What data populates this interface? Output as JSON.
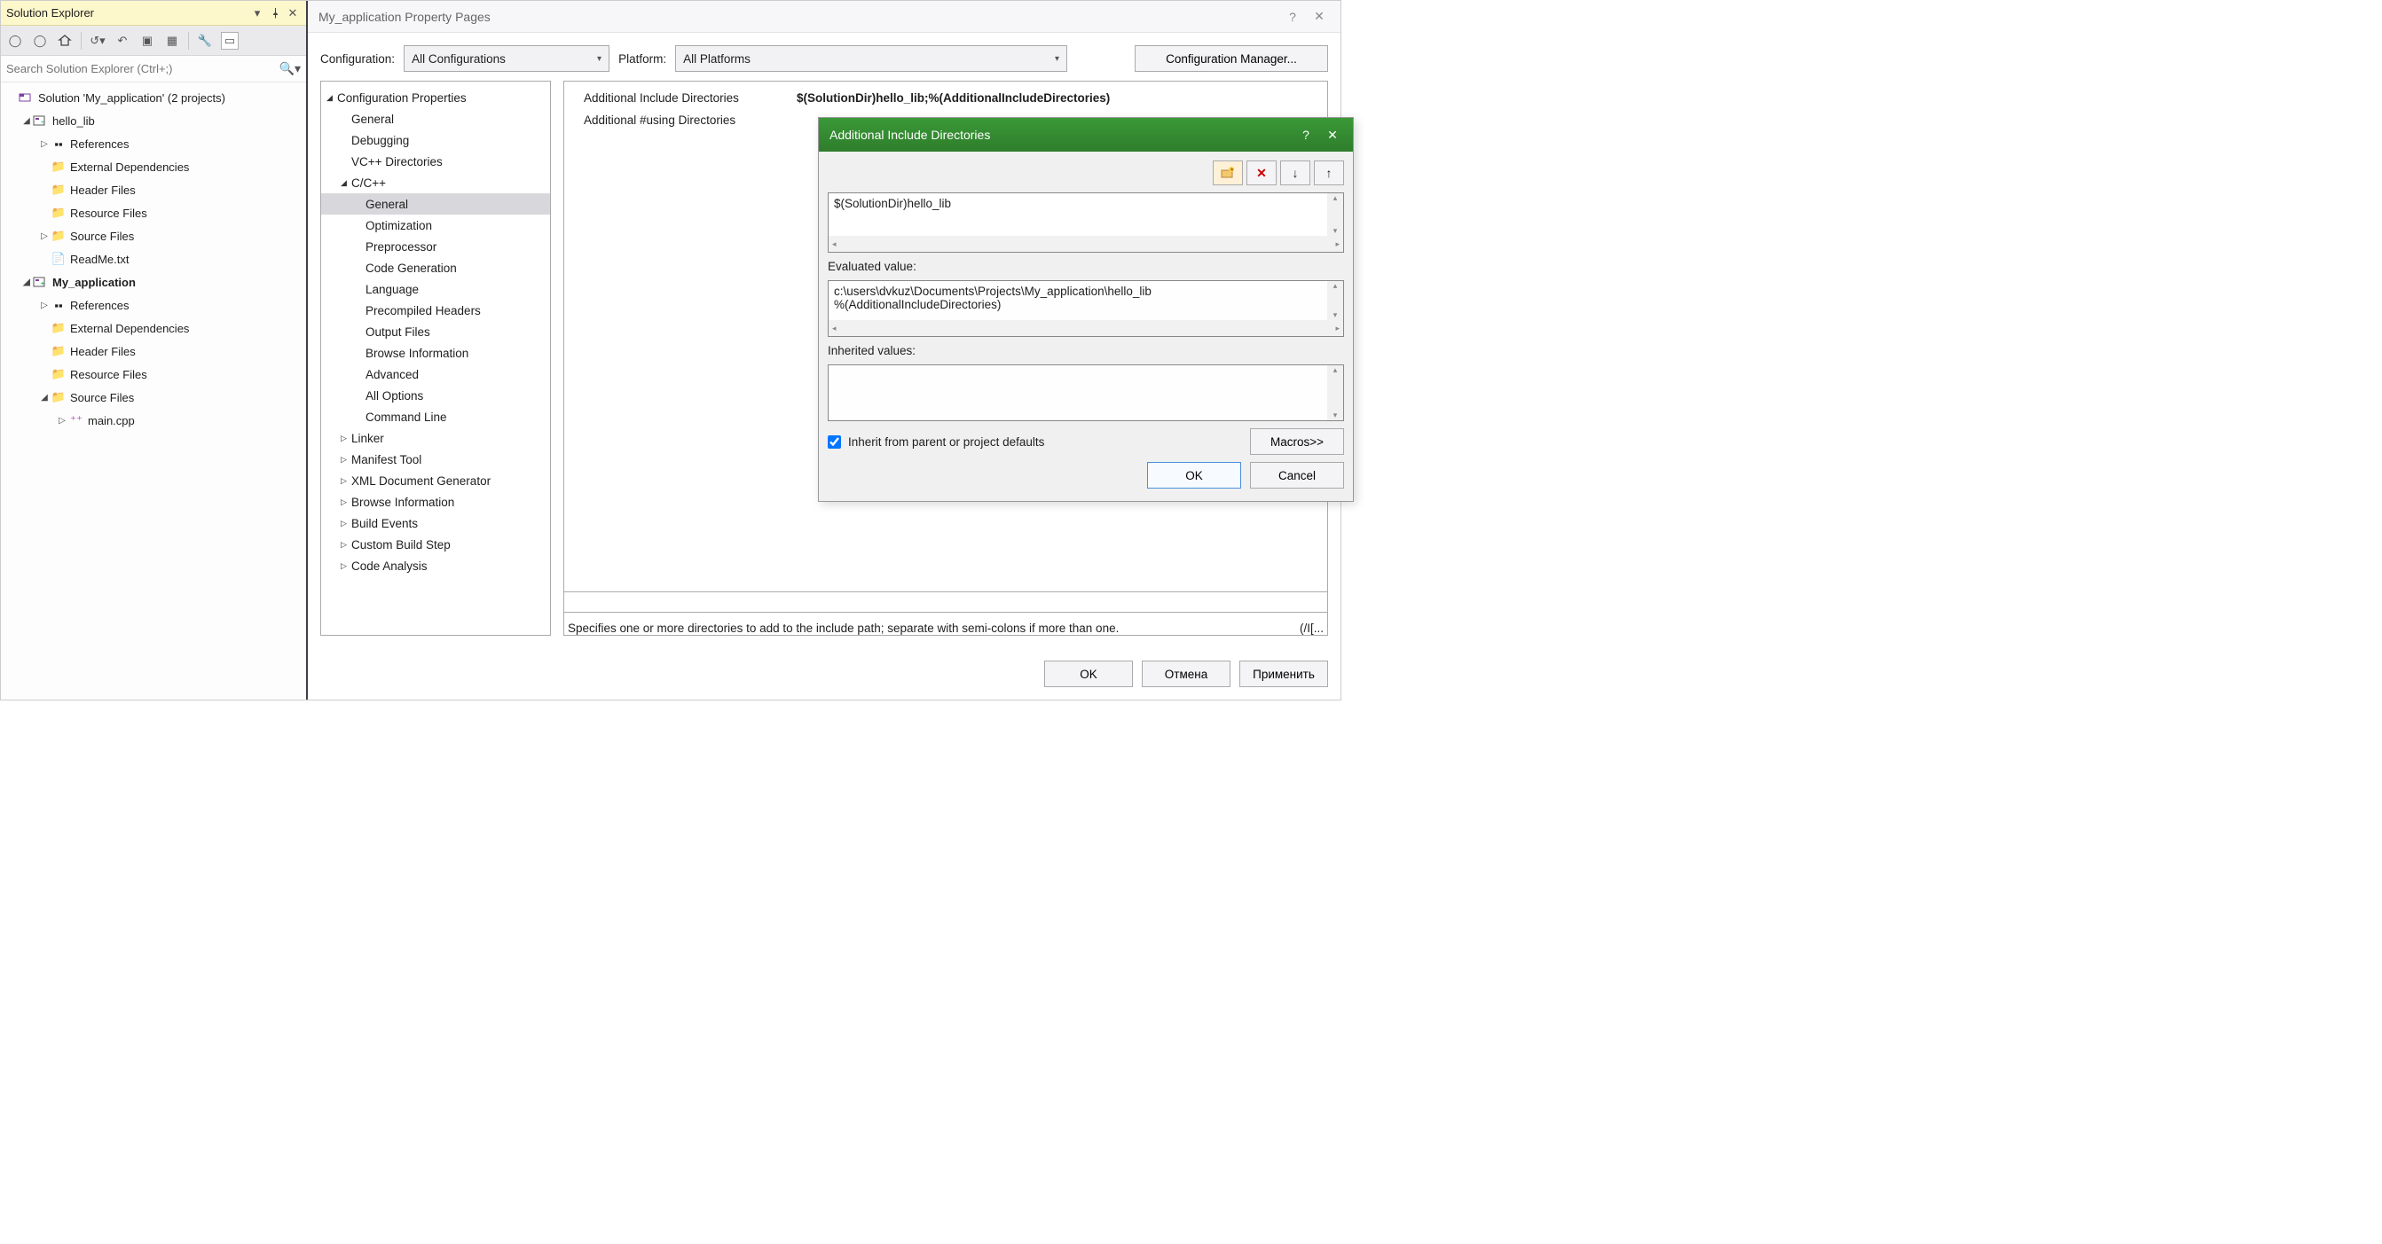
{
  "solExplorer": {
    "title": "Solution Explorer",
    "searchPlaceholder": "Search Solution Explorer (Ctrl+;)",
    "tree": {
      "solution": "Solution 'My_application' (2 projects)",
      "p1": {
        "name": "hello_lib",
        "refs": "References",
        "ext": "External Dependencies",
        "hdr": "Header Files",
        "res": "Resource Files",
        "src": "Source Files",
        "readme": "ReadMe.txt"
      },
      "p2": {
        "name": "My_application",
        "refs": "References",
        "ext": "External Dependencies",
        "hdr": "Header Files",
        "res": "Resource Files",
        "src": "Source Files",
        "main": "main.cpp"
      }
    }
  },
  "propPage": {
    "title": "My_application Property Pages",
    "cfgLabel": "Configuration:",
    "cfgValue": "All Configurations",
    "platLabel": "Platform:",
    "platValue": "All Platforms",
    "cfgMgr": "Configuration Manager...",
    "tree": {
      "root": "Configuration Properties",
      "general": "General",
      "debugging": "Debugging",
      "vcdirs": "VC++ Directories",
      "ccpp": "C/C++",
      "c_general": "General",
      "c_opt": "Optimization",
      "c_pre": "Preprocessor",
      "c_codegen": "Code Generation",
      "c_lang": "Language",
      "c_pch": "Precompiled Headers",
      "c_out": "Output Files",
      "c_browse": "Browse Information",
      "c_adv": "Advanced",
      "c_all": "All Options",
      "c_cmd": "Command Line",
      "linker": "Linker",
      "manifest": "Manifest Tool",
      "xmldoc": "XML Document Generator",
      "browseinfo": "Browse Information",
      "buildev": "Build Events",
      "custbuild": "Custom Build Step",
      "codean": "Code Analysis"
    },
    "grid": {
      "row1_label": "Additional Include Directories",
      "row1_val": "$(SolutionDir)hello_lib;%(AdditionalIncludeDirectories)",
      "row2_label": "Additional #using Directories"
    },
    "helpText": "Specifies one or more directories to add to the include path; separate with semi-colons if more than one.",
    "helpFlag": "(/I[...",
    "buttons": {
      "ok": "OK",
      "cancel": "Отмена",
      "apply": "Применить"
    }
  },
  "dialog": {
    "title": "Additional Include Directories",
    "entry": "$(SolutionDir)hello_lib",
    "evalLabel": "Evaluated value:",
    "eval_line1": "c:\\users\\dvkuz\\Documents\\Projects\\My_application\\hello_lib",
    "eval_line2": "%(AdditionalIncludeDirectories)",
    "inhLabel": "Inherited values:",
    "inheritChk": "Inherit from parent or project defaults",
    "macros": "Macros>>",
    "ok": "OK",
    "cancel": "Cancel"
  }
}
